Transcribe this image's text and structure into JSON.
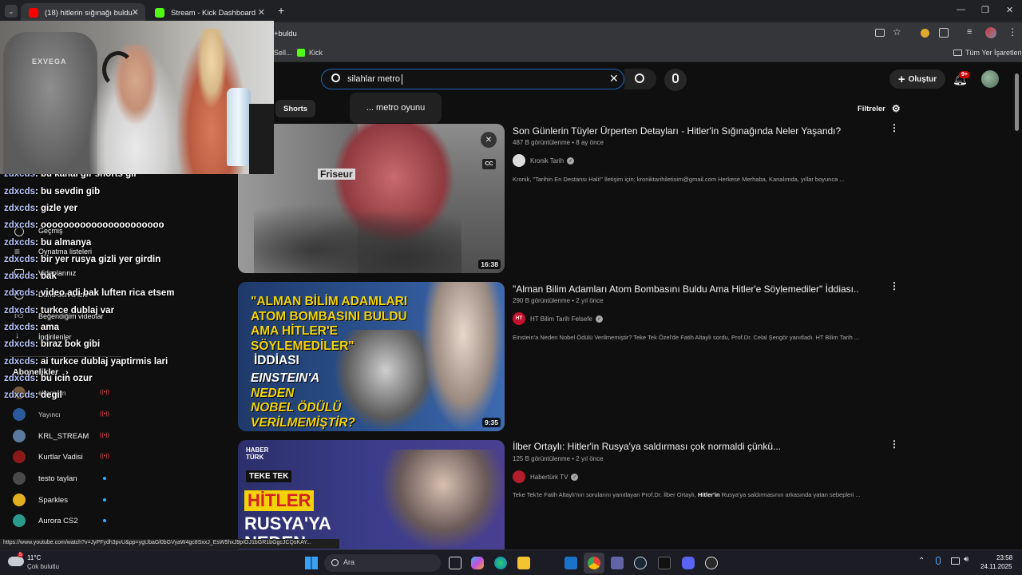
{
  "tabs": [
    {
      "title": "(18) hitlerin sığınağı buldu - Yo"
    },
    {
      "title": "Stream - Kick Dashboard"
    }
  ],
  "address": {
    "tail": "+buldu"
  },
  "bookmarks": [
    {
      "label": "Sell..."
    },
    {
      "label": "Kick"
    }
  ],
  "all_bookmarks": "Tüm Yer İşaretleri",
  "search": {
    "value": "silahlar metro ",
    "suggestion": "... metro oyunu"
  },
  "create_label": "Oluştur",
  "notifications": "9+",
  "chips": {
    "shorts": "Shorts",
    "filters": "Filtreler"
  },
  "videos": [
    {
      "title": "Son Günlerin Tüyler Ürperten Detayları - Hitler'in Sığınağında Neler Yaşandı?",
      "meta": "487 B görüntülenme • 8 ay önce",
      "channel": "Kronik Tarih",
      "desc": "Kronik, \"Tarihin En Destansı Hali!\" İletişim için: kroniktarihiletisim@gmail.com Herkese Merhaba, Kanalımda, yıllar boyunca ...",
      "duration": "16:38",
      "thumb_text": "Friseur"
    },
    {
      "title": "\"Alman Bilim Adamları Atom Bombasını Buldu Ama Hitler'e Söylemediler\" İddiası..",
      "meta": "290 B görüntülenme • 2 yıl önce",
      "channel": "HT Bilim Tarih Felsefe",
      "channel_badge": "HT",
      "desc": "Einstein'a Neden Nobel Ödülü Verilmemiştir? Teke Tek Özel'de Fatih Altaylı sordu, Prof.Dr. Celal Şengör yanıtladı. HT Bilim Tarih ...",
      "duration": "9:35",
      "thumb_lines": [
        "\"ALMAN BİLİM ADAMLARI",
        "ATOM BOMBASINI BULDU",
        "AMA HİTLER'E",
        "SÖYLEMEDİLER\"",
        "İDDİASI",
        "EINSTEIN'A",
        "NEDEN",
        "NOBEL ÖDÜLÜ",
        "VERİLMEMİŞTİR?"
      ]
    },
    {
      "title": "İlber Ortaylı: Hitler'in Rusya'ya saldırması çok normaldi çünkü...",
      "meta": "125 B görüntülenme • 2 yıl önce",
      "channel": "Habertürk TV",
      "desc_pre": "Teke Tek'te Fatih Altaylı'nın sorularını yanıtlayan Prof.Dr. İlber Ortaylı, ",
      "desc_bold": "Hitler'in",
      "desc_post": " Rusya'ya saldırmasının arkasında yatan sebepleri ...",
      "thumb_brand": [
        "HABER",
        "TÜRK"
      ],
      "thumb_tag": "TEKE TEK",
      "thumb_lines": [
        "HİTLER",
        "RUSYA'YA",
        "NEDEN"
      ]
    }
  ],
  "sidebar": {
    "items": [
      "Geçmiş",
      "Oynatma listeleri",
      "Videolarınız",
      "Daha sonra izle",
      "Beğendiğim videolar",
      "İndirilenler"
    ],
    "subs_header": "Abonelikler",
    "subs": [
      "ebonivon",
      "Yayıncı",
      "KRL_STREAM",
      "Kurtlar Vadisi",
      "testo taylan",
      "Sparkles",
      "Aurora CS2"
    ]
  },
  "chat": [
    {
      "user": "zdxcds",
      "msg": ": losthistorie"
    },
    {
      "user": "zdxcds",
      "msg": ": bu kanal gir shorts gir"
    },
    {
      "user": "zdxcds",
      "msg": ": bu sevdin gib"
    },
    {
      "user": "zdxcds",
      "msg": ": gizle yer"
    },
    {
      "user": "zdxcds",
      "msg": ": oooooooooooooooooooooo"
    },
    {
      "user": "zdxcds",
      "msg": ": bu almanya"
    },
    {
      "user": "zdxcds",
      "msg": ": bir yer rusya gizli yer girdin"
    },
    {
      "user": "zdxcds",
      "msg": ": bak"
    },
    {
      "user": "zdxcds",
      "msg": ": video adi bak luften rica etsem"
    },
    {
      "user": "zdxcds",
      "msg": ": turkce dublaj var"
    },
    {
      "user": "zdxcds",
      "msg": ": ama"
    },
    {
      "user": "zdxcds",
      "msg": ": biraz bok gibi"
    },
    {
      "user": "zdxcds",
      "msg": ": ai turkce dublaj yaptirmis lari"
    },
    {
      "user": "zdxcds",
      "msg": ": bu icin ozur"
    },
    {
      "user": "zdxcds",
      "msg": ": degil"
    }
  ],
  "cam": {
    "chair_brand": "EXVEGA"
  },
  "status_url": "https://www.youtube.com/watch?v=JyPFydh3pvU&pp=ygUbaGl0bGVyaW4gc8SxxJ_EsW5hxJ9pIGJ1bGR1bGgcJCQsKAY...",
  "taskbar": {
    "weather_temp": "11°C",
    "weather_desc": "Çok bulutlu",
    "search_placeholder": "Ara",
    "time": "23:58",
    "date": "24.11.2025",
    "badge": "5"
  }
}
